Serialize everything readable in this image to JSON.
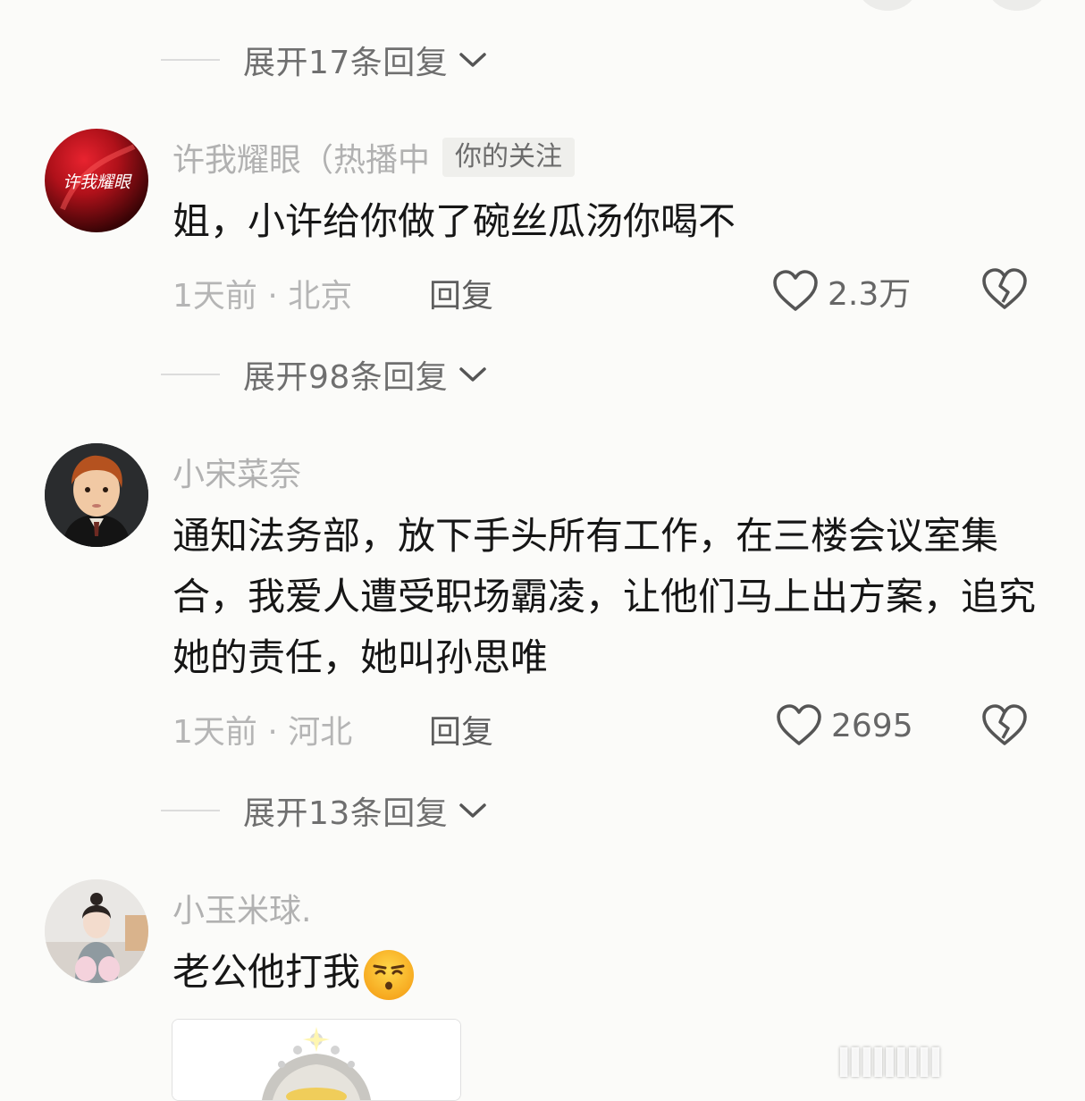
{
  "threads": [
    {
      "expand_label": "展开17条回复"
    },
    {
      "expand_label": "展开98条回复"
    },
    {
      "expand_label": "展开13条回复"
    }
  ],
  "comments": [
    {
      "username": "许我耀眼（热播中",
      "badge": "你的关注",
      "avatar_text": "许我耀眼",
      "text": "姐，小许给你做了碗丝瓜汤你喝不",
      "time": "1天前 · 北京",
      "reply_label": "回复",
      "likes": "2.3万"
    },
    {
      "username": "小宋菜奈",
      "text": "通知法务部，放下手头所有工作，在三楼会议室集合，我爱人遭受职场霸凌，让他们马上出方案，追究她的责任，她叫孙思唯",
      "time": "1天前 · 河北",
      "reply_label": "回复",
      "likes": "2695"
    },
    {
      "username": "小玉米球.",
      "text": "老公他打我",
      "emoji": "whistling-face-emoji"
    }
  ],
  "watermark": "▌▌▌▌▌▌▌▌▌",
  "colors": {
    "background": "#fbfbf9",
    "meta": "#b1b1b1",
    "text": "#161616"
  }
}
